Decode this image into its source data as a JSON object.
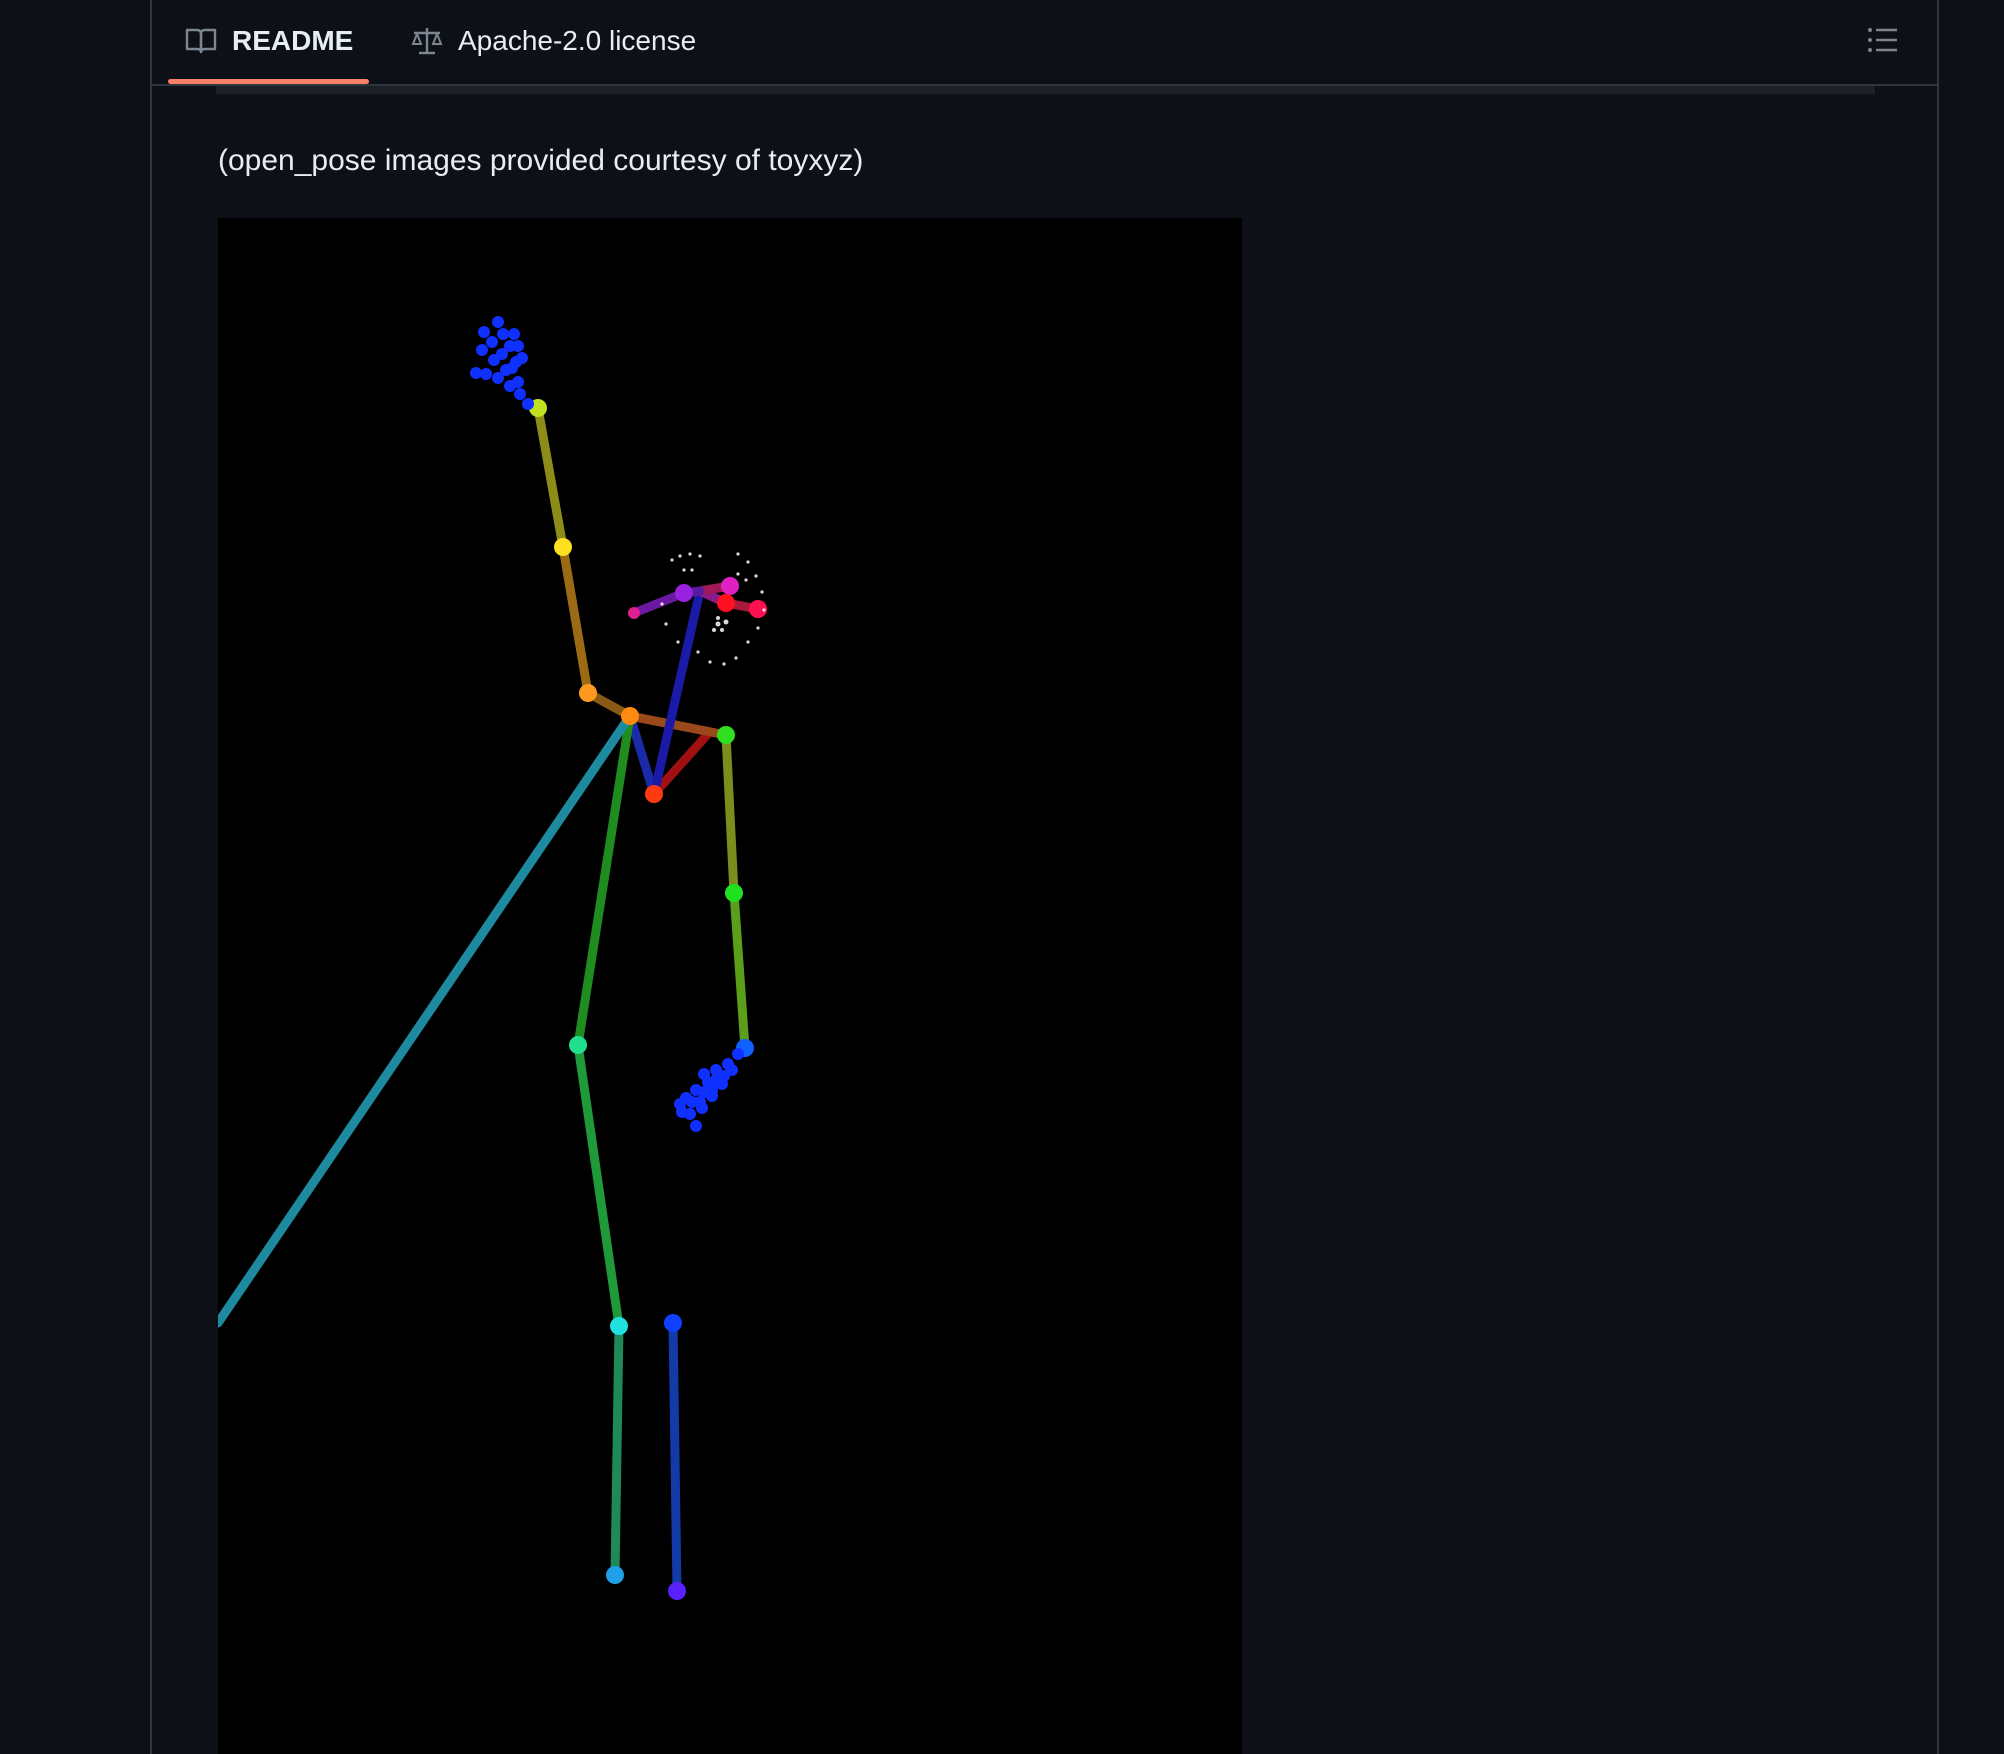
{
  "tabs": [
    {
      "label": "README",
      "icon": "book-icon",
      "active": true
    },
    {
      "label": "Apache-2.0 license",
      "icon": "law-icon",
      "active": false
    }
  ],
  "toc_icon": "list-unordered-icon",
  "content": {
    "caption": "(open_pose images provided courtesy of toyxyz)"
  },
  "colors": {
    "background": "#0d1117",
    "border": "#30363d",
    "active_tab_underline": "#f78166",
    "text": "#e6edf3",
    "muted": "#7d8590"
  }
}
